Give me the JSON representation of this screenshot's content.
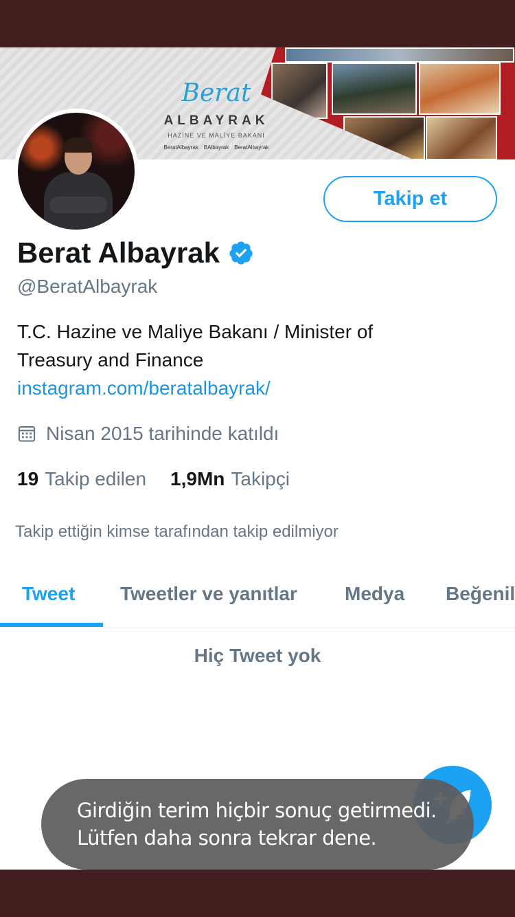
{
  "profile": {
    "name": "Berat Albayrak",
    "handle": "@BeratAlbayrak",
    "bio_text": "T.C. Hazine ve Maliye Bakanı / Minister of Treasury and Finance ",
    "bio_link": "instagram.com/beratalbayrak/",
    "joined": "Nisan 2015 tarihinde katıldı",
    "following_count": "19",
    "following_label": "Takip edilen",
    "followers_count": "1,9Mn",
    "followers_label": "Takipçi",
    "not_followed_note": "Takip ettiğin kimse tarafından takip edilmiyor",
    "verified": true
  },
  "banner": {
    "script": "Berat",
    "main": "ALBAYRAK",
    "subtitle": "HAZİNE VE MALİYE BAKANI",
    "social": [
      "BeratAlbayrak",
      "BAlbayrak",
      "BeratAlbayrak"
    ]
  },
  "actions": {
    "follow_label": "Takip et"
  },
  "tabs": [
    {
      "label": "Tweet",
      "active": true
    },
    {
      "label": "Tweetler ve yanıtlar",
      "active": false
    },
    {
      "label": "Medya",
      "active": false
    },
    {
      "label": "Beğeniler",
      "active": false
    }
  ],
  "empty_state": "Hiç Tweet yok",
  "toast": {
    "line1": "Girdiğin terim hiçbir sonuç getirmedi.",
    "line2": "Lütfen daha sonra tekrar dene."
  },
  "colors": {
    "accent": "#1da1f2",
    "link": "#1b95e0",
    "text_primary": "#14171a",
    "text_secondary": "#657786",
    "frame": "#401f1e",
    "toast_bg": "#5c5c5c"
  },
  "icons": {
    "verified": "verified-badge-icon",
    "joined": "calendar-icon",
    "compose": "compose-tweet-icon"
  }
}
